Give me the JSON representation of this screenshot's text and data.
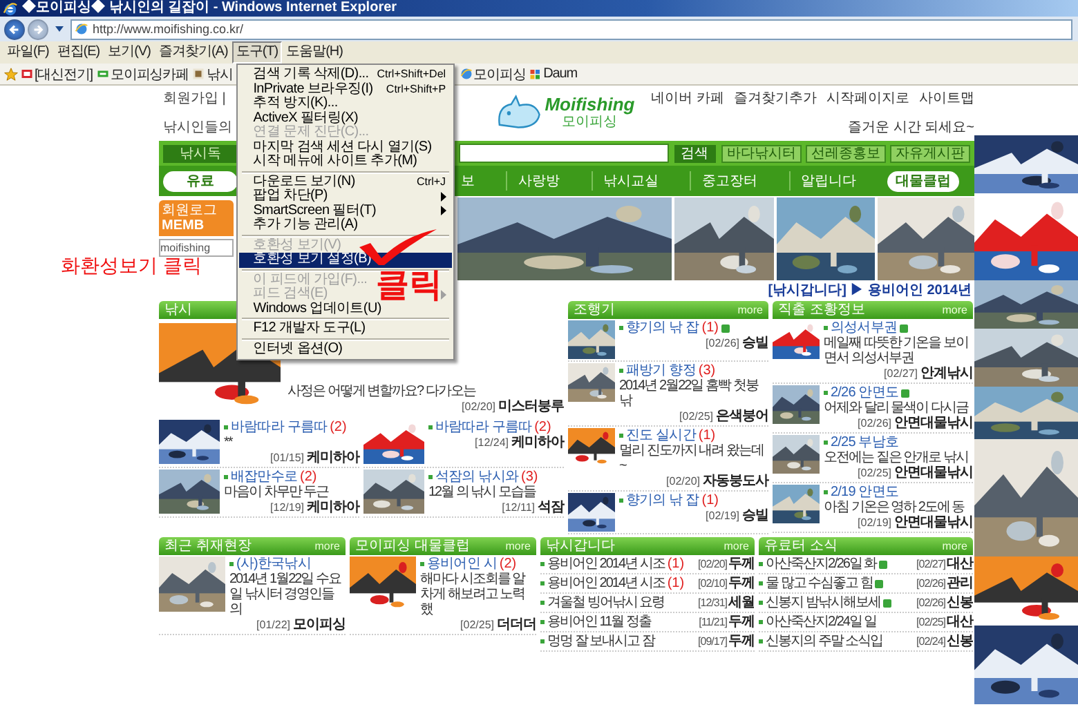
{
  "window": {
    "title": "◆모이피싱◆ 낚시인의 길잡이 - Windows Internet Explorer"
  },
  "address_bar": {
    "url": "http://www.moifishing.co.kr/"
  },
  "menu_bar": [
    {
      "label": "파일(F)",
      "selected": false
    },
    {
      "label": "편집(E)",
      "selected": false
    },
    {
      "label": "보기(V)",
      "selected": false
    },
    {
      "label": "즐겨찾기(A)",
      "selected": false
    },
    {
      "label": "도구(T)",
      "selected": true
    },
    {
      "label": "도움말(H)",
      "selected": false
    }
  ],
  "favorites_bar": {
    "left": [
      {
        "label": "[대신전기]"
      },
      {
        "label": "모이피싱카페"
      },
      {
        "label": "낚시"
      }
    ],
    "right": [
      {
        "label": "모이피싱"
      },
      {
        "label": "Daum"
      }
    ]
  },
  "tools_menu": {
    "groups": [
      [
        {
          "label": "검색 기록 삭제(D)...",
          "shortcut": "Ctrl+Shift+Del",
          "disabled": false,
          "submenu": false,
          "selected": false
        },
        {
          "label": "InPrivate 브라우징(I)",
          "shortcut": "Ctrl+Shift+P",
          "disabled": false,
          "submenu": false,
          "selected": false
        },
        {
          "label": "추적 방지(K)...",
          "disabled": false,
          "submenu": false,
          "selected": false
        },
        {
          "label": "ActiveX 필터링(X)",
          "disabled": false,
          "submenu": false,
          "selected": false
        },
        {
          "label": "연결 문제 진단(C)...",
          "disabled": true,
          "submenu": false,
          "selected": false
        },
        {
          "label": "마지막 검색 세션 다시 열기(S)",
          "disabled": false,
          "submenu": false,
          "selected": false
        },
        {
          "label": "시작 메뉴에 사이트 추가(M)",
          "disabled": false,
          "submenu": false,
          "selected": false
        }
      ],
      [
        {
          "label": "다운로드 보기(N)",
          "shortcut": "Ctrl+J",
          "disabled": false,
          "submenu": false,
          "selected": false
        },
        {
          "label": "팝업 차단(P)",
          "disabled": false,
          "submenu": true,
          "selected": false
        },
        {
          "label": "SmartScreen 필터(T)",
          "disabled": false,
          "submenu": true,
          "selected": false
        },
        {
          "label": "추가 기능 관리(A)",
          "disabled": false,
          "submenu": false,
          "selected": false
        }
      ],
      [
        {
          "label": "호환성 보기(V)",
          "disabled": true,
          "submenu": false,
          "selected": false
        },
        {
          "label": "호환성 보기 설정(B)",
          "disabled": false,
          "submenu": false,
          "selected": true
        }
      ],
      [
        {
          "label": "이 피드에 가입(F)...",
          "disabled": true,
          "submenu": false,
          "selected": false
        },
        {
          "label": "피드 검색(E)",
          "disabled": true,
          "submenu": true,
          "selected": false
        },
        {
          "label": "Windows 업데이트(U)",
          "disabled": false,
          "submenu": false,
          "selected": false
        }
      ],
      [
        {
          "label": "F12 개발자 도구(L)",
          "disabled": false,
          "submenu": false,
          "selected": false
        }
      ],
      [
        {
          "label": "인터넷 옵션(O)",
          "disabled": false,
          "submenu": false,
          "selected": false
        }
      ]
    ]
  },
  "annotations": {
    "side_note": "화환성보기 클릭",
    "menu_note": "클릭"
  },
  "page": {
    "top_left": [
      "회원가입 |",
      "낚시인들의"
    ],
    "logo": {
      "name": "Moifishing",
      "subtitle": "모이피싱"
    },
    "top_links": [
      "네이버 카페",
      "즐겨찾기추가",
      "시작페이지로",
      "사이트맵"
    ],
    "greeting": "즐거운 시간 되세요~",
    "search_bar": {
      "left_button": "낚시독",
      "search_button": "검색",
      "buttons": [
        "바다낚시터",
        "선레종홍보",
        "자유게시판"
      ]
    },
    "nav": {
      "left_button": "유료",
      "items": [
        "보",
        "사랑방",
        "낚시교실",
        "중고장터",
        "알립니다"
      ],
      "right_button": "대물클럽"
    },
    "member_box": {
      "title": "회원로그",
      "subtitle": "MEMB",
      "field": "moifishing"
    },
    "banners": [
      {
        "kind": "picture"
      },
      {
        "kind": "picture"
      },
      {
        "kind": "picture"
      },
      {
        "kind": "picture"
      }
    ],
    "ticker": "[낚시갑니다] ▶ 용비어인 2014년",
    "feature": {
      "header": "낚시",
      "excerpt": "사정은 어떻게 변할까요? 다가오는",
      "date": "[02/20]",
      "author": "미스터붕루"
    },
    "small_posts": [
      {
        "title": "바람따라 구름따",
        "count": "(2)",
        "desc": "**",
        "date": "[01/15]",
        "author": "케미하아"
      },
      {
        "title": "바람따라 구름따",
        "count": "(2)",
        "date": "[12/24]",
        "author": "케미하아"
      },
      {
        "title": "배잡만수로",
        "count": "(2)",
        "desc": "마음이 차무만 두근",
        "date": "[12/19]",
        "author": "케미하아"
      },
      {
        "title": "석잠의 낚시와",
        "count": "(3)",
        "desc": "12월 의 낚시 모습들",
        "date": "[12/11]",
        "author": "석잠"
      }
    ],
    "boards": [
      {
        "header": "조행기",
        "more": "more",
        "posts": [
          {
            "title": "향기의 낚 잡",
            "count": "(1)",
            "new": true,
            "date": "[02/26]",
            "author": "승빌"
          },
          {
            "title": "패방기 향정",
            "count": "(3)",
            "new": false,
            "desc": "2014년 2월22일 홈빡 첫붕낚",
            "date": "[02/25]",
            "author": "은색붕어"
          },
          {
            "title": "진도 실시간",
            "count": "(1)",
            "new": false,
            "desc": "멀리 진도까지 내려 왔는데~",
            "date": "[02/20]",
            "author": "자동붕도사"
          },
          {
            "title": "향기의 낚 잡",
            "count": "(1)",
            "new": false,
            "date": "[02/19]",
            "author": "승빌"
          }
        ]
      },
      {
        "header": "직출 조황정보",
        "more": "more",
        "posts": [
          {
            "title": "의성서부권",
            "new": true,
            "desc": "메일째 따뜻한 기온을 보이면서 의성서부권",
            "date": "[02/27]",
            "author": "안계낚시"
          },
          {
            "title": "2/26 안면도",
            "new": true,
            "desc": "어제와 달리 물색이 다시금",
            "date": "[02/26]",
            "author": "안면대물낚시"
          },
          {
            "title": "2/25 부남호",
            "new": false,
            "desc": "오전에는 짙은 안개로 낚시",
            "date": "[02/25]",
            "author": "안면대물낚시"
          },
          {
            "title": "2/19 안면도",
            "new": false,
            "desc": "아침 기온은 영하 2도에 동",
            "date": "[02/19]",
            "author": "안면대물낚시"
          }
        ]
      }
    ],
    "bottom_boards": [
      {
        "header": "최근 취재현장",
        "more": "more",
        "posts": [
          {
            "title": "(사)한국낚시",
            "desc": "2014년 1월22일 수요일 낚시터 경영인들의",
            "date": "[01/22]",
            "author": "모이피싱"
          }
        ]
      },
      {
        "header": "모이피싱 대물클럽",
        "more": "more",
        "posts": [
          {
            "title": "용비어인 시",
            "count": "(2)",
            "desc": "해마다 시조회를 알차게 해보려고 노력 했",
            "date": "[02/25]",
            "author": "더더더"
          }
        ]
      },
      {
        "header": "낚시갑니다",
        "more": "more",
        "rows": [
          {
            "title": "용비어인 2014년 시조",
            "count": "(1)",
            "new": false,
            "date": "[02/20]",
            "author": "두께"
          },
          {
            "title": "용비어인 2014년 시조",
            "count": "(1)",
            "new": false,
            "date": "[02/10]",
            "author": "두께"
          },
          {
            "title": "겨울철 빙어낚시 요령",
            "new": false,
            "date": "[12/31]",
            "author": "세월"
          },
          {
            "title": "용비어인 11월 정출",
            "new": false,
            "date": "[11/21]",
            "author": "두께"
          },
          {
            "title": "멍멍 잘 보내시고 잠",
            "new": false,
            "date": "[09/17]",
            "author": "두께"
          }
        ]
      },
      {
        "header": "유료터 소식",
        "more": "more",
        "rows": [
          {
            "title": "아산죽산지2/26일 화",
            "new": true,
            "date": "[02/27]",
            "author": "대산"
          },
          {
            "title": "물 많고 수심좋고 힘",
            "new": true,
            "date": "[02/26]",
            "author": "관리"
          },
          {
            "title": "신봉지 밤낚시해보세",
            "new": true,
            "date": "[02/26]",
            "author": "신봉"
          },
          {
            "title": "아산죽산지2/24일 일",
            "new": false,
            "date": "[02/25]",
            "author": "대산"
          },
          {
            "title": "신봉지의 주말 소식입",
            "new": false,
            "date": "[02/24]",
            "author": "신봉"
          }
        ]
      }
    ],
    "side_banners": [
      {
        "kind": "picture"
      },
      {
        "kind": "picture"
      },
      {
        "kind": "picture"
      },
      {
        "kind": "picture"
      },
      {
        "kind": "picture"
      },
      {
        "kind": "picture"
      },
      {
        "kind": "picture"
      },
      {
        "kind": "picture"
      }
    ]
  }
}
